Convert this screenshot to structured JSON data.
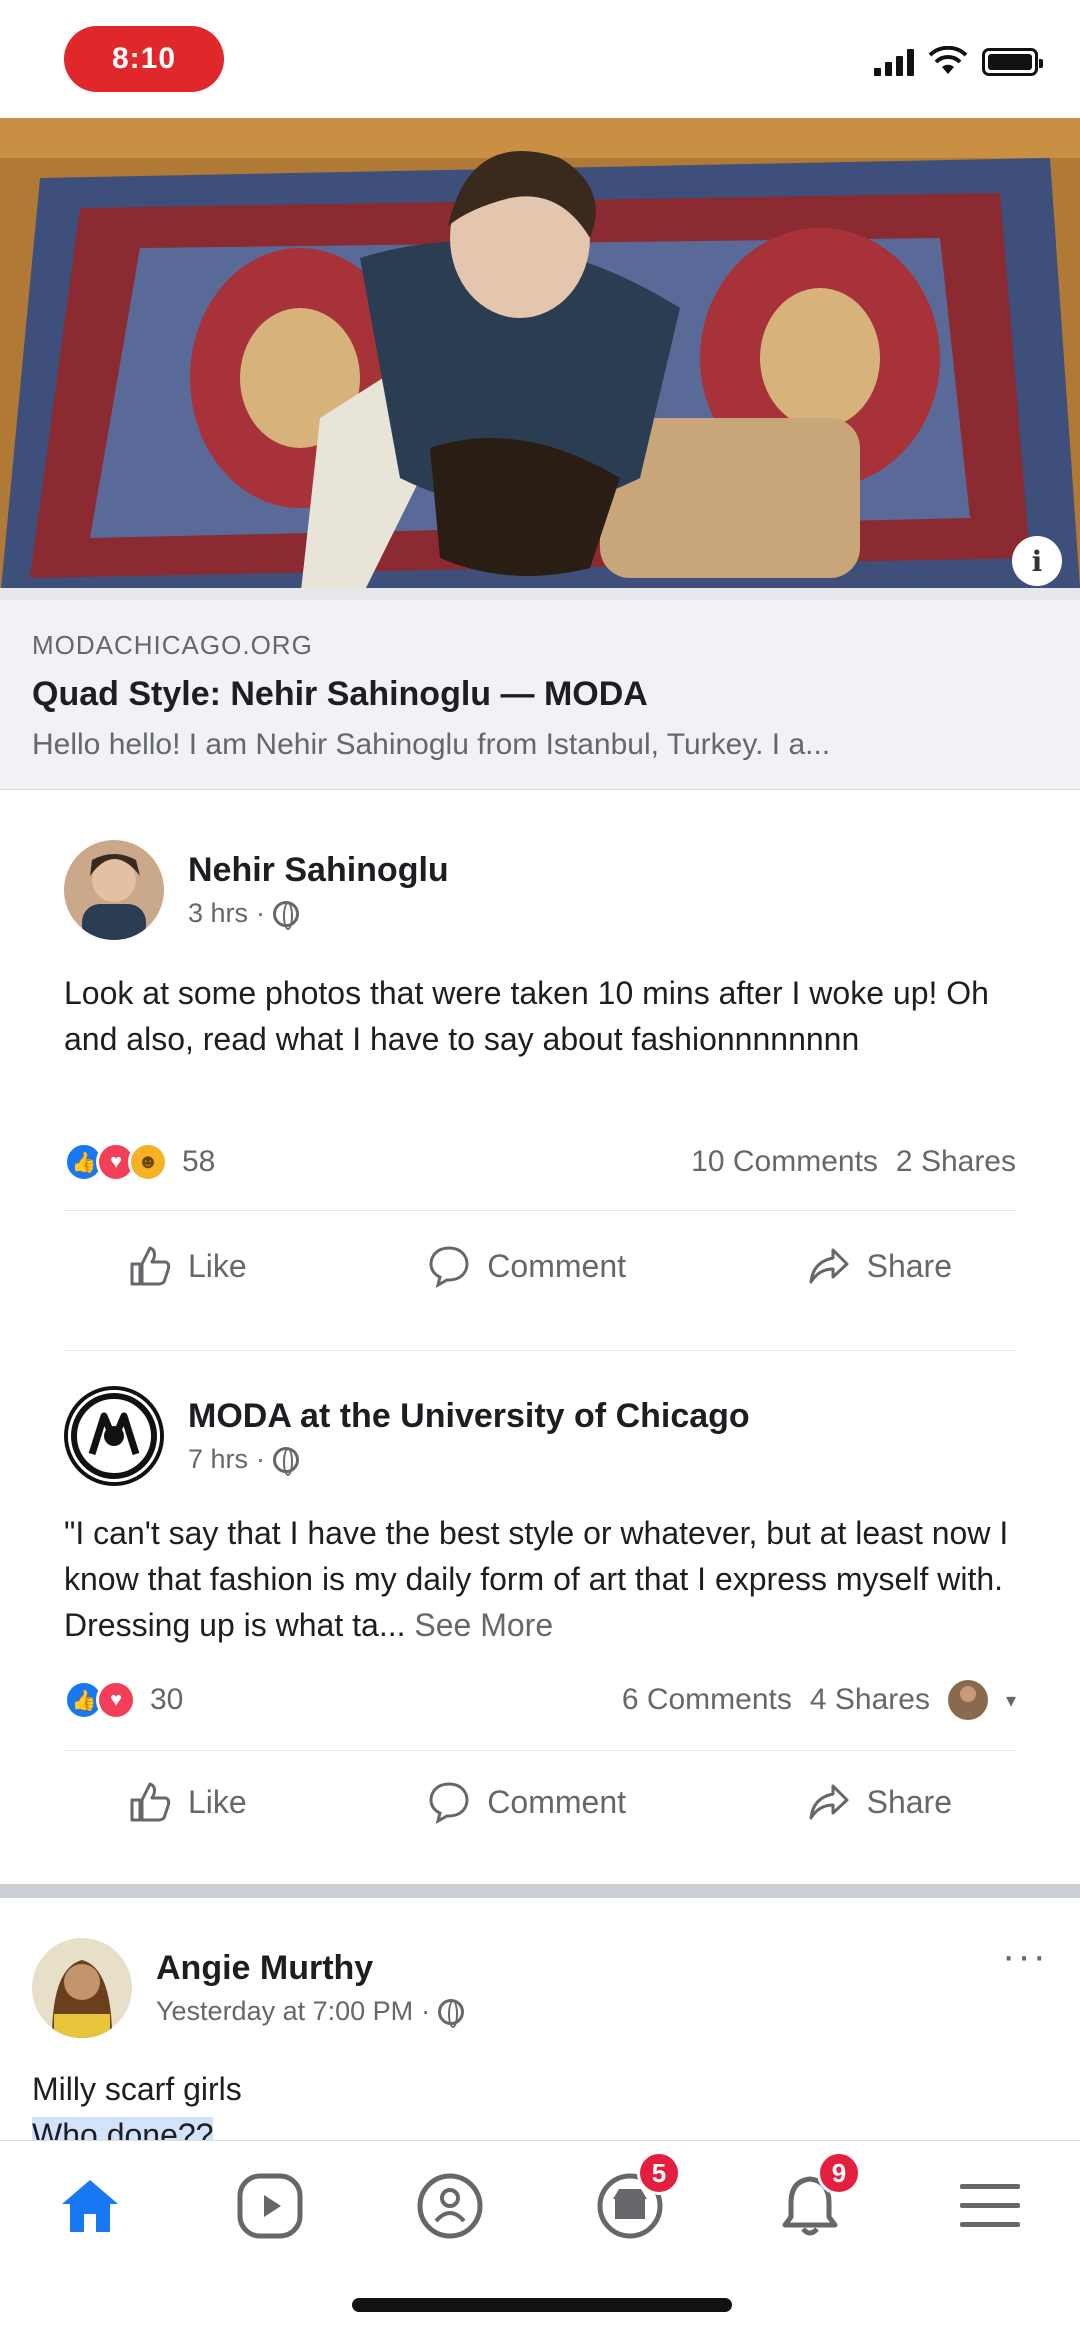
{
  "status_bar": {
    "time": "8:10"
  },
  "link_preview": {
    "domain": "MODACHICAGO.ORG",
    "title": "Quad Style: Nehir Sahinoglu — MODA",
    "description": "Hello hello! I am Nehir Sahinoglu from Istanbul, Turkey. I a..."
  },
  "posts": [
    {
      "author": "Nehir Sahinoglu",
      "time": "3 hrs",
      "text": "Look at some photos that were taken 10 mins after I woke up! Oh and also, read what I have to say about fashionnnnnnnn",
      "see_more": "",
      "reaction_count": "58",
      "comments": "10 Comments",
      "shares": "2 Shares"
    },
    {
      "author": "MODA at the University of Chicago",
      "time": "7 hrs",
      "text": "\"I can't say that I have the best style or whatever, but at least now I know that fashion is my daily form of art that I express myself with. Dressing up is what ta...",
      "see_more": "See More",
      "reaction_count": "30",
      "comments": "6 Comments",
      "shares": "4 Shares"
    },
    {
      "author": "Angie Murthy",
      "time": "Yesterday at 7:00 PM",
      "text": "Milly scarf girls",
      "text2": "Who done??"
    }
  ],
  "actions": {
    "like": "Like",
    "comment": "Comment",
    "share": "Share"
  },
  "more_dots": "···",
  "nav": {
    "items": [
      "home-icon",
      "watch-icon",
      "groups-icon",
      "marketplace-icon",
      "notifications-icon",
      "menu-icon"
    ],
    "badges": {
      "marketplace": "5",
      "notifications": "9"
    }
  },
  "colors": {
    "brand": "#1877f2",
    "badge": "#e41e3f",
    "rec": "#e0272b"
  }
}
